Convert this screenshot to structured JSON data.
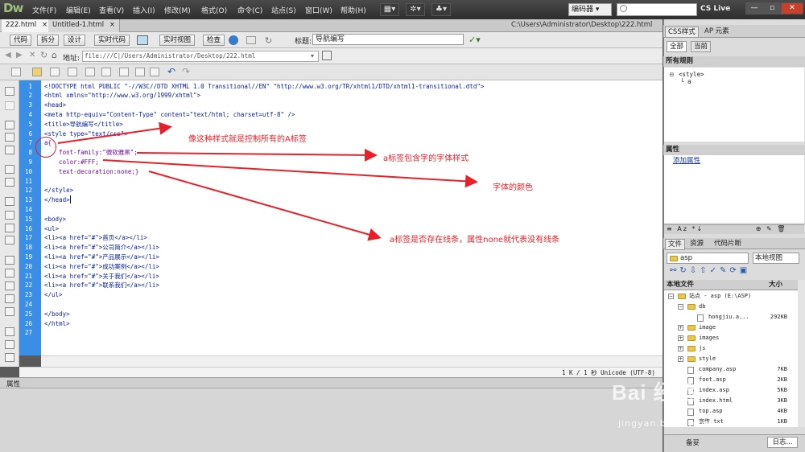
{
  "app": {
    "logo": "Dw",
    "menu": [
      "文件(F)",
      "编辑(E)",
      "查看(V)",
      "插入(I)",
      "修改(M)",
      "格式(O)",
      "命令(C)",
      "站点(S)",
      "窗口(W)",
      "帮助(H)"
    ],
    "workspace": "编码器 ▾",
    "search_placeholder": "",
    "cslive": "CS Live"
  },
  "tabs": [
    {
      "label": "222.html",
      "close": "×",
      "active": true
    },
    {
      "label": "Untitled-1.html",
      "close": "×",
      "active": false
    }
  ],
  "doc_path": "C:\\Users\\Administrator\\Desktop\\222.html",
  "doc_toolbar": {
    "code": "代码",
    "split": "拆分",
    "design": "设计",
    "live_code": "实时代码",
    "live_view": "实时视图",
    "inspect": "检查",
    "title_label": "标题:",
    "title_value": "导航编写"
  },
  "address": {
    "label": "地址:",
    "value": "file:///C|/Users/Administrator/Desktop/222.html"
  },
  "code_lines": [
    "<!DOCTYPE html PUBLIC \"-//W3C//DTD XHTML 1.0 Transitional//EN\" \"http://www.w3.org/TR/xhtml1/DTD/xhtml1-transitional.dtd\">",
    "<html xmlns=\"http://www.w3.org/1999/xhtml\">",
    "<head>",
    "<meta http-equiv=\"Content-Type\" content=\"text/html; charset=utf-8\" />",
    "<title>导航编写</title>",
    "<style type=\"text/css\">",
    "a{",
    "    font-family:\"微软雅黑\";",
    "    color:#FFF;",
    "    text-decoration:none;}",
    "",
    "</style>",
    "</head>",
    "",
    "<body>",
    "<ul>",
    "<li><a href=\"#\">首页</a></li>",
    "<li><a href=\"#\">公司简介</a></li>",
    "<li><a href=\"#\">产品展示</a></li>",
    "<li><a href=\"#\">成功案例</a></li>",
    "<li><a href=\"#\">关于我们</a></li>",
    "<li><a href=\"#\">联系我们</a></li>",
    "</ul>",
    "",
    "</body>",
    "</html>",
    ""
  ],
  "line_numbers": [
    "1",
    "2",
    "3",
    "4",
    "5",
    "6",
    "7",
    "8",
    "9",
    "10",
    "11",
    "12",
    "13",
    "14",
    "15",
    "16",
    "17",
    "18",
    "19",
    "20",
    "21",
    "22",
    "23",
    "24",
    "25",
    "26",
    "27"
  ],
  "annotations": [
    "像这种样式就是控制所有的A标签",
    "a标签包含字的字体样式",
    "字体的颜色",
    "a标签是否存在线条，属性none就代表没有线条"
  ],
  "status": "1 K / 1 秒  Unicode (UTF-8)",
  "properties_label": "属性",
  "right_panel": {
    "css_tab": "CSS样式",
    "ap_tab": "AP 元素",
    "all_btn": "全部",
    "current_btn": "当前",
    "all_rules_label": "所有规则",
    "rules": [
      "<style>",
      "└ a"
    ],
    "props_label": "属性",
    "add_prop": "添加属性",
    "files_tabs": [
      "文件",
      "资源",
      "代码片断"
    ],
    "site_select": "asp",
    "view_select": "本地视图",
    "local_files_col": "本地文件",
    "size_col": "大小",
    "files": [
      {
        "name": "站点 - asp (E:\\ASP)",
        "size": ""
      },
      {
        "name": "db",
        "size": ""
      },
      {
        "name": "hongjiu.a...",
        "size": "292KB"
      },
      {
        "name": "image",
        "size": ""
      },
      {
        "name": "images",
        "size": ""
      },
      {
        "name": "js",
        "size": ""
      },
      {
        "name": "style",
        "size": ""
      },
      {
        "name": "company.asp",
        "size": "7KB"
      },
      {
        "name": "foot.asp",
        "size": "2KB"
      },
      {
        "name": "index.asp",
        "size": "5KB"
      },
      {
        "name": "index.html",
        "size": "3KB"
      },
      {
        "name": "top.asp",
        "size": "4KB"
      },
      {
        "name": "宣传.txt",
        "size": "1KB"
      }
    ],
    "ready": "备妥",
    "log_btn": "日志..."
  },
  "watermark": "Bai 经验",
  "watermark_url": "jingyan.baidu.com",
  "colors": {
    "gutter": "#3a8ee6",
    "annotation": "#e8202a",
    "titlebar": "#3a3a3a"
  }
}
